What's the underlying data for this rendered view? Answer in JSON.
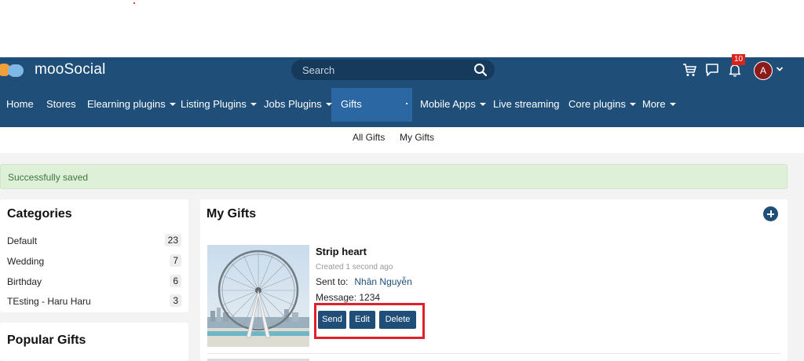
{
  "brand": {
    "name": "mooSocial"
  },
  "header": {
    "search_placeholder": "Search",
    "notification_count": "10",
    "avatar_initial": "A",
    "colors": {
      "bar": "#1f4e79",
      "badge": "#d9241b",
      "avatar": "#8b1a1a"
    },
    "icons": [
      "cart-icon",
      "chat-icon",
      "bell-icon",
      "chevron-down-icon",
      "search-icon"
    ]
  },
  "nav": {
    "items": [
      "Home",
      "Stores",
      "Elearning plugins",
      "Listing Plugins",
      "Jobs Plugins",
      "Gifts",
      "Mobile Apps",
      "Live streaming",
      "Core plugins",
      "More"
    ],
    "active": "Gifts"
  },
  "subnav": {
    "all_gifts": "All Gifts",
    "my_gifts": "My Gifts"
  },
  "alert": {
    "message": "Successfully saved"
  },
  "categories": {
    "title": "Categories",
    "items": [
      {
        "label": "Default",
        "count": "23"
      },
      {
        "label": "Wedding",
        "count": "7"
      },
      {
        "label": "Birthday",
        "count": "6"
      },
      {
        "label": "TEsting - Haru Haru",
        "count": "3"
      }
    ]
  },
  "popular": {
    "title": "Popular Gifts"
  },
  "my_gifts": {
    "title": "My Gifts",
    "gift": {
      "name": "Strip heart",
      "created": "Created 1 second ago",
      "sent_label": "Sent to:",
      "sent_to": "Nhân Nguyễn",
      "message_label": "Message:",
      "message": "1234",
      "actions": {
        "send": "Send",
        "edit": "Edit",
        "delete": "Delete"
      }
    }
  }
}
